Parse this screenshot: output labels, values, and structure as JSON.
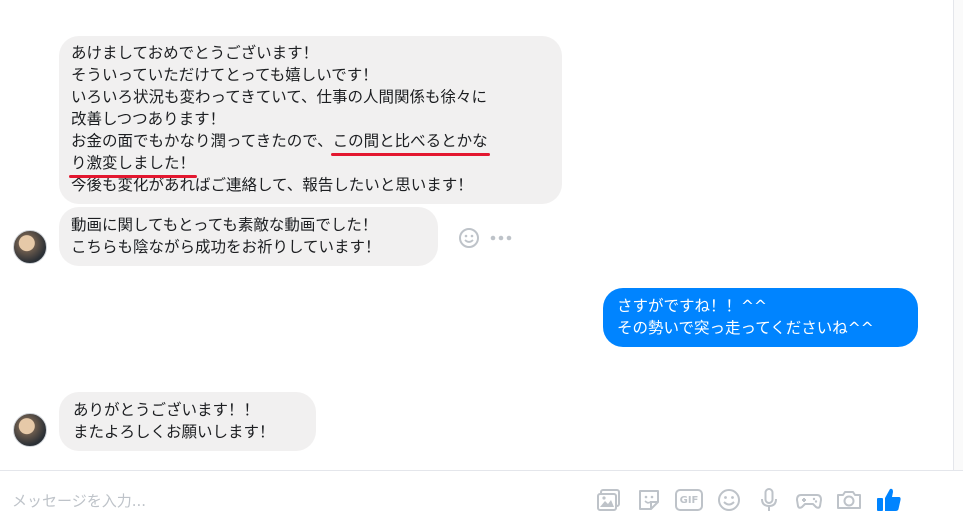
{
  "messages": [
    {
      "lines": [
        "あけましておめでとうございます！",
        "そういっていただけてとっても嬉しいです！",
        "いろいろ状況も変わってきていて、仕事の人間関係も徐々に",
        "改善しつつあります！"
      ],
      "line5_plain": "お金の面でもかなり潤ってきたので、",
      "line5_highlight": "この間と比べるとかな",
      "line6_highlight": "り激変しました！",
      "line7": "今後も変化があればご連絡して、報告したいと思います！"
    },
    {
      "lines": [
        "動画に関してもとっても素敵な動画でした！",
        "こちらも陰ながら成功をお祈りしています！"
      ]
    },
    {
      "lines": [
        "さすがですね！！^^",
        "その勢いで突っ走ってくださいね^^"
      ]
    },
    {
      "lines": [
        "ありがとうございます！！",
        "またよろしくお願いします！"
      ]
    }
  ],
  "composer": {
    "placeholder": "メッセージを入力..."
  },
  "toolbar": {
    "gif_label": "GIF",
    "icons": [
      "image-icon",
      "sticker-icon",
      "gif-icon",
      "emoji-icon",
      "microphone-icon",
      "game-controller-icon",
      "camera-icon",
      "thumbs-up-icon"
    ]
  },
  "colors": {
    "incoming_bubble": "#f1f0f0",
    "outgoing_bubble": "#0084ff",
    "highlight_underline": "#e3172f",
    "icon_gray": "#bec3c9",
    "like_blue": "#0084ff"
  }
}
